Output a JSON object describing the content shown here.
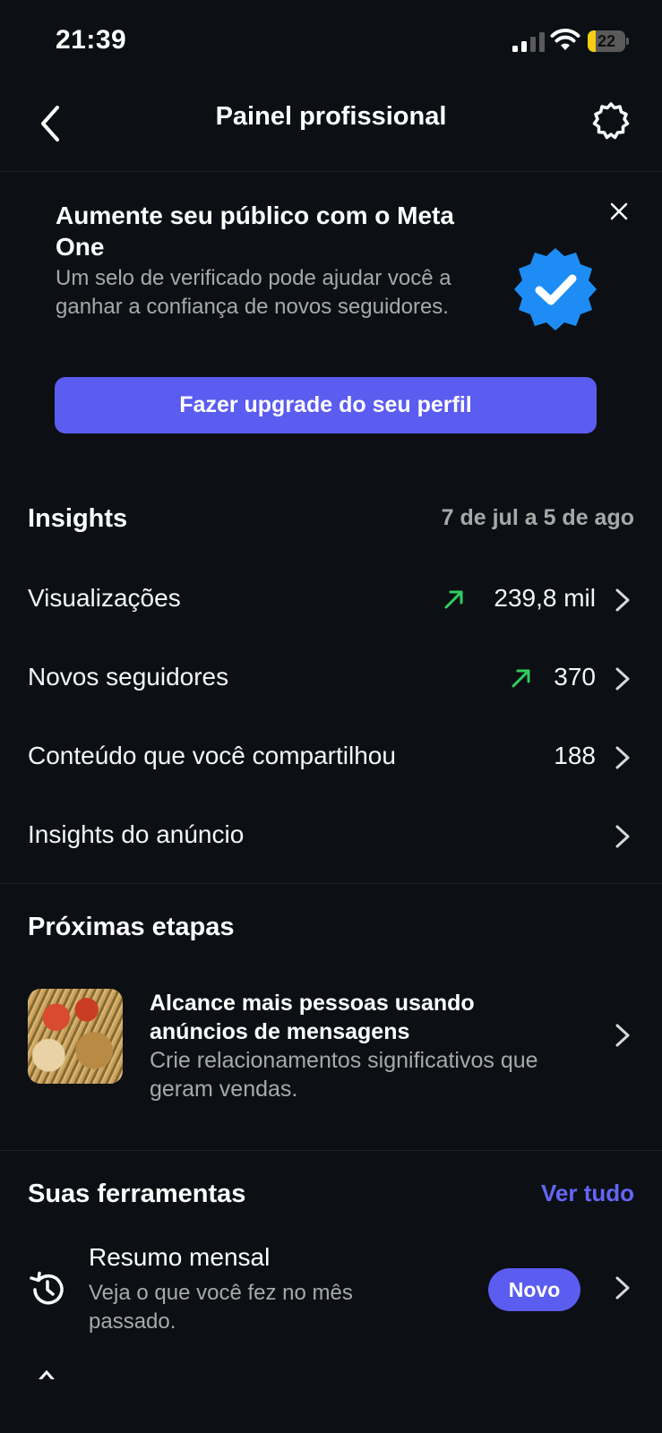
{
  "status_bar": {
    "time": "21:39",
    "battery_level": "22",
    "battery_fraction": 0.22,
    "battery_color": "#f5cd14",
    "icons": [
      "cellular-signal-icon",
      "wifi-icon",
      "battery-icon"
    ]
  },
  "header": {
    "title": "Painel profissional",
    "back_icon": "chevron-left-icon",
    "settings_icon": "gear-icon"
  },
  "promo": {
    "title": "Aumente seu público com o Meta One",
    "description": "Um selo de verificado pode ajudar você a ganhar a confiança de novos seguidores.",
    "button_label": "Fazer upgrade do seu perfil",
    "badge_icon": "verified-badge-icon",
    "close_icon": "close-icon",
    "badge_color": "#1d8df5",
    "button_color": "#5b5cf0"
  },
  "insights": {
    "title": "Insights",
    "date_range": "7 de jul a 5 de ago",
    "rows": [
      {
        "label": "Visualizações",
        "value": "239,8 mil",
        "trend": "up"
      },
      {
        "label": "Novos seguidores",
        "value": "370",
        "trend": "up"
      },
      {
        "label": "Conteúdo que você compartilhou",
        "value": "188",
        "trend": ""
      },
      {
        "label": "Insights do anúncio",
        "value": "",
        "trend": ""
      }
    ],
    "trend_color": "#2fce5e"
  },
  "next_steps": {
    "title": "Próximas etapas",
    "item": {
      "title": "Alcance mais pessoas usando anúncios de mensagens",
      "description": "Crie relacionamentos significativos que geram vendas."
    }
  },
  "tools": {
    "title": "Suas ferramentas",
    "see_all": "Ver tudo",
    "accent_color": "#6366f5",
    "items": [
      {
        "title": "Resumo mensal",
        "description": "Veja o que você fez no mês passado.",
        "badge": "Novo",
        "icon": "history-clock-icon"
      }
    ]
  }
}
